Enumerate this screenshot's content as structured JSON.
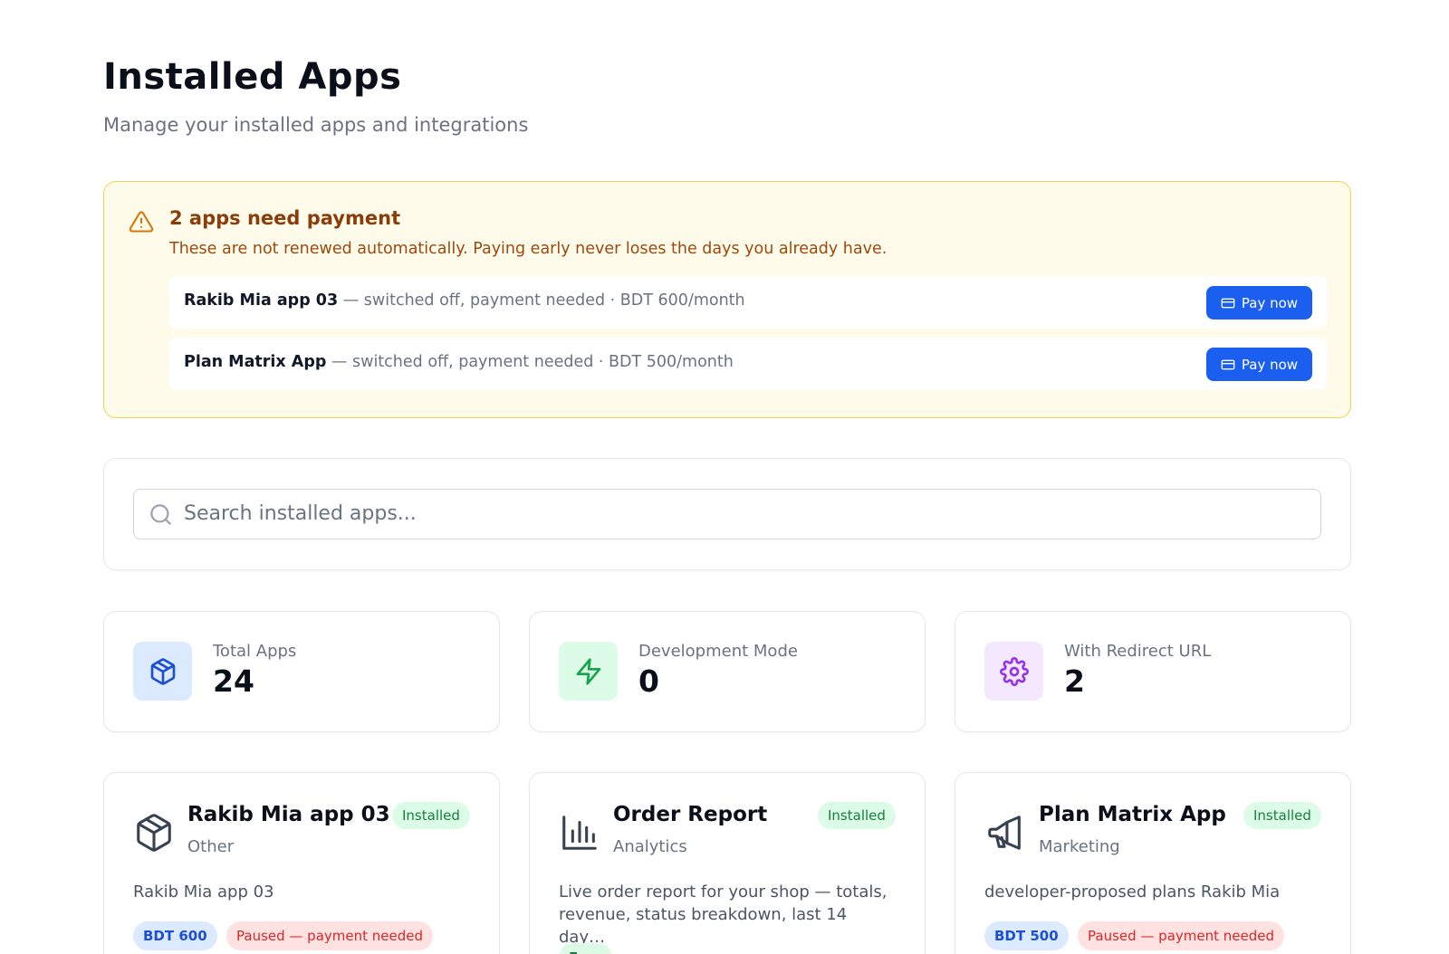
{
  "header": {
    "title": "Installed Apps",
    "subtitle": "Manage your installed apps and integrations"
  },
  "alert": {
    "icon": "warning-triangle-icon",
    "title": "2 apps need payment",
    "description": "These are not renewed automatically. Paying early never loses the days you already have.",
    "items": [
      {
        "name": "Rakib Mia app 03",
        "detail": " — switched off, payment needed · BDT 600/month",
        "button": "Pay now"
      },
      {
        "name": "Plan Matrix App",
        "detail": " — switched off, payment needed · BDT 500/month",
        "button": "Pay now"
      }
    ],
    "colors": {
      "background": "#fffbeb",
      "border": "#f5cf4f",
      "title": "#8a3d0a",
      "button": "#1a5ff0"
    }
  },
  "search": {
    "placeholder": "Search installed apps...",
    "value": ""
  },
  "stats": [
    {
      "label": "Total Apps",
      "value": "24",
      "icon": "box-icon",
      "color": "#1d4ed8"
    },
    {
      "label": "Development Mode",
      "value": "0",
      "icon": "lightning-icon",
      "color": "#16a34a"
    },
    {
      "label": "With Redirect URL",
      "value": "2",
      "icon": "gear-icon",
      "color": "#9333ea"
    }
  ],
  "apps": [
    {
      "name": "Rakib Mia app 03",
      "category": "Other",
      "status": "Installed",
      "description": "Rakib Mia app 03",
      "icon": "box-icon",
      "price": "BDT 600",
      "state": "Paused — payment needed"
    },
    {
      "name": "Order Report",
      "category": "Analytics",
      "status": "Installed",
      "description": "Live order report for your shop — totals, revenue, status breakdown, last 14 day…",
      "icon": "bar-chart-icon",
      "price": "Free"
    },
    {
      "name": "Plan Matrix App",
      "category": "Marketing",
      "status": "Installed",
      "description": "developer-proposed plans Rakib Mia",
      "icon": "megaphone-icon",
      "price": "BDT 500",
      "state": "Paused — payment needed"
    }
  ]
}
